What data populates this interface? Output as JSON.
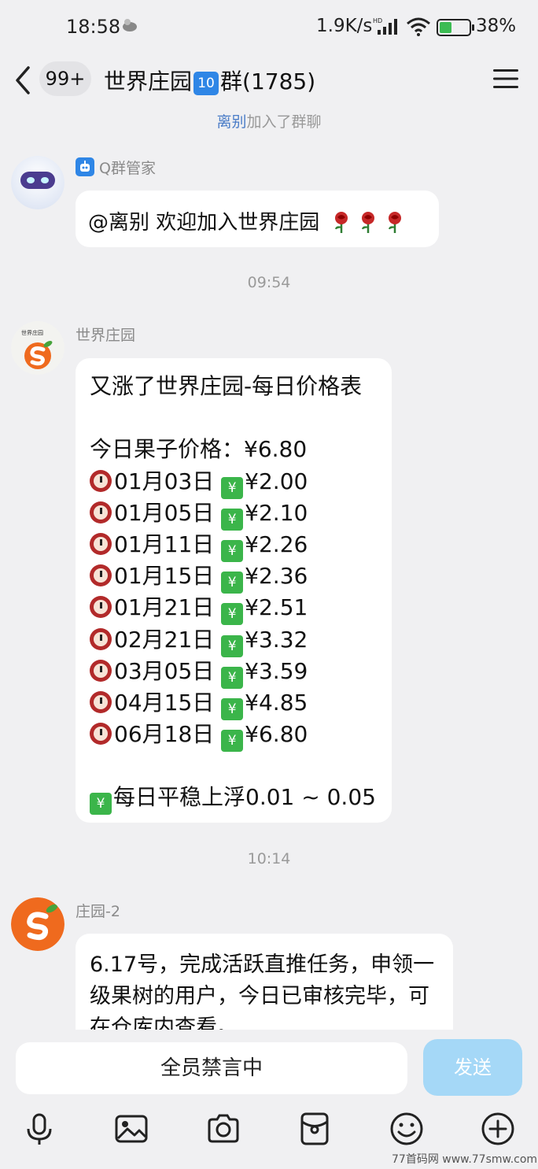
{
  "status_bar": {
    "time": "18:58",
    "network_speed": "1.9K/s",
    "battery": "38%",
    "battery_level": 0.38
  },
  "header": {
    "unread_badge": "99+",
    "title_prefix": "世界庄园",
    "title_badge": "10",
    "title_suffix": "群(1785)"
  },
  "system_notice": {
    "name": "离别",
    "text": "加入了群聊"
  },
  "messages": [
    {
      "sender": "Q群管家",
      "text": "@离别 欢迎加入世界庄园"
    },
    {
      "timestamp": "09:54",
      "sender": "世界庄园",
      "title": "又涨了世界庄园-每日价格表",
      "today_price": "今日果子价格：¥6.80",
      "rows": [
        {
          "date": "01月03日",
          "price": "¥2.00"
        },
        {
          "date": "01月05日",
          "price": "¥2.10"
        },
        {
          "date": "01月11日",
          "price": "¥2.26"
        },
        {
          "date": "01月15日",
          "price": "¥2.36"
        },
        {
          "date": "01月21日",
          "price": "¥2.51"
        },
        {
          "date": "02月21日",
          "price": "¥3.32"
        },
        {
          "date": "03月05日",
          "price": "¥3.59"
        },
        {
          "date": "04月15日",
          "price": "¥4.85"
        },
        {
          "date": "06月18日",
          "price": "¥6.80"
        }
      ],
      "footer": "每日平稳上浮0.01 ~ 0.05"
    },
    {
      "timestamp": "10:14",
      "sender": "庄园-2",
      "text": "6.17号，完成活跃直推任务，申领一级果树的用户，今日已审核完毕，可在仓库内查看。"
    }
  ],
  "input": {
    "placeholder": "全员禁言中",
    "send_label": "发送"
  },
  "toolbar": [
    "microphone-icon",
    "image-icon",
    "camera-icon",
    "red-packet-icon",
    "emoji-icon",
    "plus-icon"
  ],
  "watermark": "77首码网 www.77smw.com",
  "colors": {
    "accent_blue": "#2f86e6",
    "send_button": "#a5d8f7",
    "name_link": "#4a7cc7",
    "chart_green": "#3bb54a"
  }
}
